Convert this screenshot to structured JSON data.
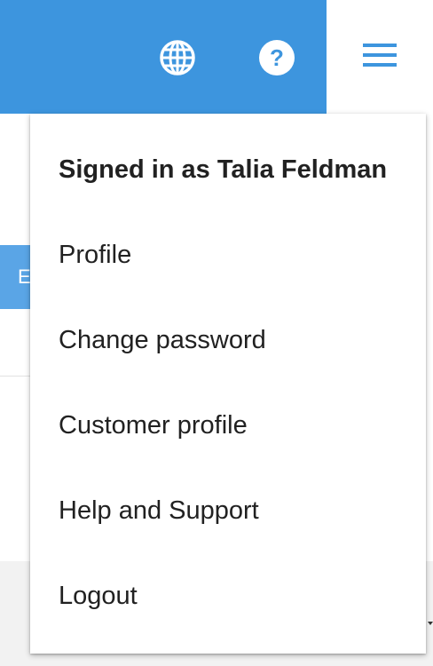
{
  "header": {
    "icons": {
      "language": "globe-icon",
      "help": "help-circle-icon",
      "menu": "hamburger-menu-icon"
    },
    "colors": {
      "bar": "#3d95de",
      "menu_tab": "#ffffff"
    }
  },
  "background": {
    "button_label": "E"
  },
  "user_menu": {
    "signed_in_label": "Signed in as Talia Feldman",
    "items": [
      {
        "label": "Profile"
      },
      {
        "label": "Change password"
      },
      {
        "label": "Customer profile"
      },
      {
        "label": "Help and Support"
      },
      {
        "label": "Logout"
      }
    ]
  }
}
